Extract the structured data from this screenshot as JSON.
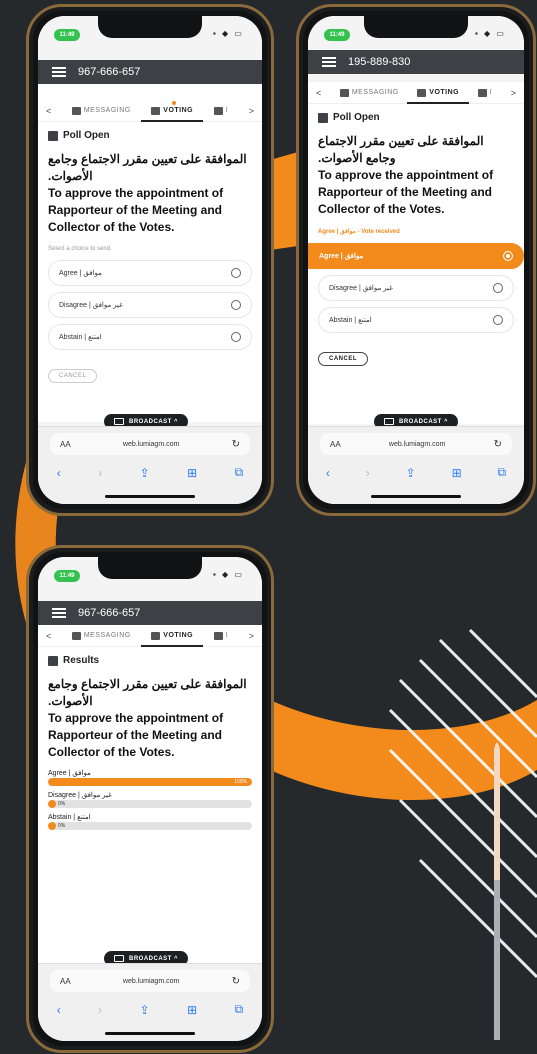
{
  "colors": {
    "accent": "#f28a1c",
    "background": "#25292c",
    "topbar": "#3d4145"
  },
  "phones": [
    {
      "status_time": "11:49",
      "status_icons": "▪ ◆ ▭",
      "phone_number": "967-666-657",
      "tabs": [
        "MESSAGING",
        "VOTING",
        "I"
      ],
      "tab_nav": {
        "prev": "<",
        "next": ">"
      },
      "poll_status": "Poll Open",
      "question_ar": "الموافقة على تعيين مقرر الاجتماع وجامع الأصوات.",
      "question_en": "To approve the appointment of Rapporteur of the Meeting and Collector of the Votes.",
      "hint": "Select a choice to send.",
      "choices": [
        "Agree | موافق",
        "Disagree | غير موافق",
        "Abstain | امتنع"
      ],
      "cancel_label": "CANCEL",
      "broadcast_label": "BROADCAST ^",
      "url": "web.lumiagm.com",
      "aa": "AA"
    },
    {
      "status_time": "11:49",
      "status_icons": "▪ ◆ ▭",
      "phone_number": "195-889-830",
      "tabs": [
        "MESSAGING",
        "VOTING",
        "I"
      ],
      "tab_nav": {
        "prev": "<",
        "next": ">"
      },
      "poll_status": "Poll Open",
      "question_ar": "الموافقة على تعيين مقرر الاجتماع وجامع الأصوات.",
      "question_en": "To approve the appointment of Rapporteur of the Meeting and Collector of the Votes.",
      "hint": "Agree | موافق - Vote received",
      "choices": [
        "Agree | موافق",
        "Disagree | غير موافق",
        "Abstain | امتنع"
      ],
      "cancel_label": "CANCEL",
      "broadcast_label": "BROADCAST ^",
      "url": "web.lumiagm.com",
      "aa": "AA"
    },
    {
      "status_time": "11:49",
      "status_icons": "▪ ◆ ▭",
      "phone_number": "967-666-657",
      "tabs": [
        "MESSAGING",
        "VOTING",
        "I"
      ],
      "tab_nav": {
        "prev": "<",
        "next": ">"
      },
      "poll_status": "Results",
      "question_ar": "الموافقة على تعيين مقرر الاجتماع وجامع الأصوات.",
      "question_en": "To approve the appointment of Rapporteur of the Meeting and Collector of the Votes.",
      "results": [
        {
          "label": "Agree | موافق",
          "value": 100,
          "pct": "100%"
        },
        {
          "label": "Disagree | غير موافق",
          "value": 0,
          "pct": "0%"
        },
        {
          "label": "Abstain | امتنع",
          "value": 0,
          "pct": "0%"
        }
      ],
      "broadcast_label": "BROADCAST ^",
      "url": "web.lumiagm.com",
      "aa": "AA"
    }
  ]
}
